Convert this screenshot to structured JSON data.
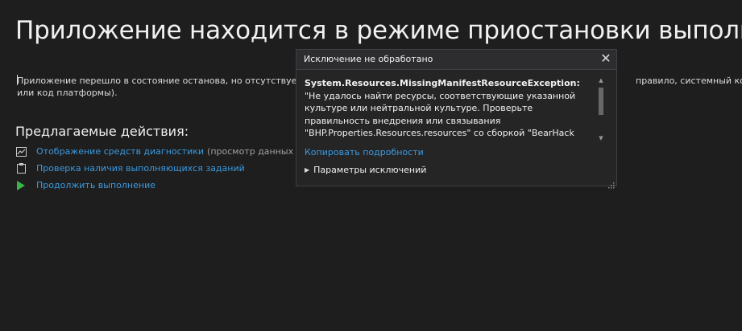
{
  "title": "Приложение находится в режиме приостановки выполнения",
  "description": {
    "text_left": "Приложение перешло в состояние останова, но отсутствует ко",
    "text_right": "правило, системный код",
    "line2": "или код платформы)."
  },
  "actions": {
    "heading": "Предлагаемые действия:",
    "items": [
      {
        "icon": "diagnostics-icon",
        "label": "Отображение средств диагностики",
        "hint": "(просмотр данных о п"
      },
      {
        "icon": "clipboard-icon",
        "label": "Проверка наличия выполняющихся заданий",
        "hint": ""
      },
      {
        "icon": "play-icon",
        "label": "Продолжить выполнение",
        "hint": ""
      }
    ]
  },
  "popup": {
    "title": "Исключение не обработано",
    "close": "✕",
    "exception_type": "System.Resources.MissingManifestResourceException:",
    "message": " \"Не удалось найти ресурсы, соответствующие указанной культуре или нейтральной культуре.  Проверьте правильность внедрения или связывания \"BHP.Properties.Resources.resources\" со сборкой \"BearHack Project\" во время компиляции, или",
    "copy_details": "Копировать подробности",
    "exception_settings": "Параметры исключений"
  },
  "colors": {
    "background": "#1e1e1e",
    "link": "#3b9ae1",
    "play_green": "#39b54a",
    "popup_bg": "#252526"
  }
}
